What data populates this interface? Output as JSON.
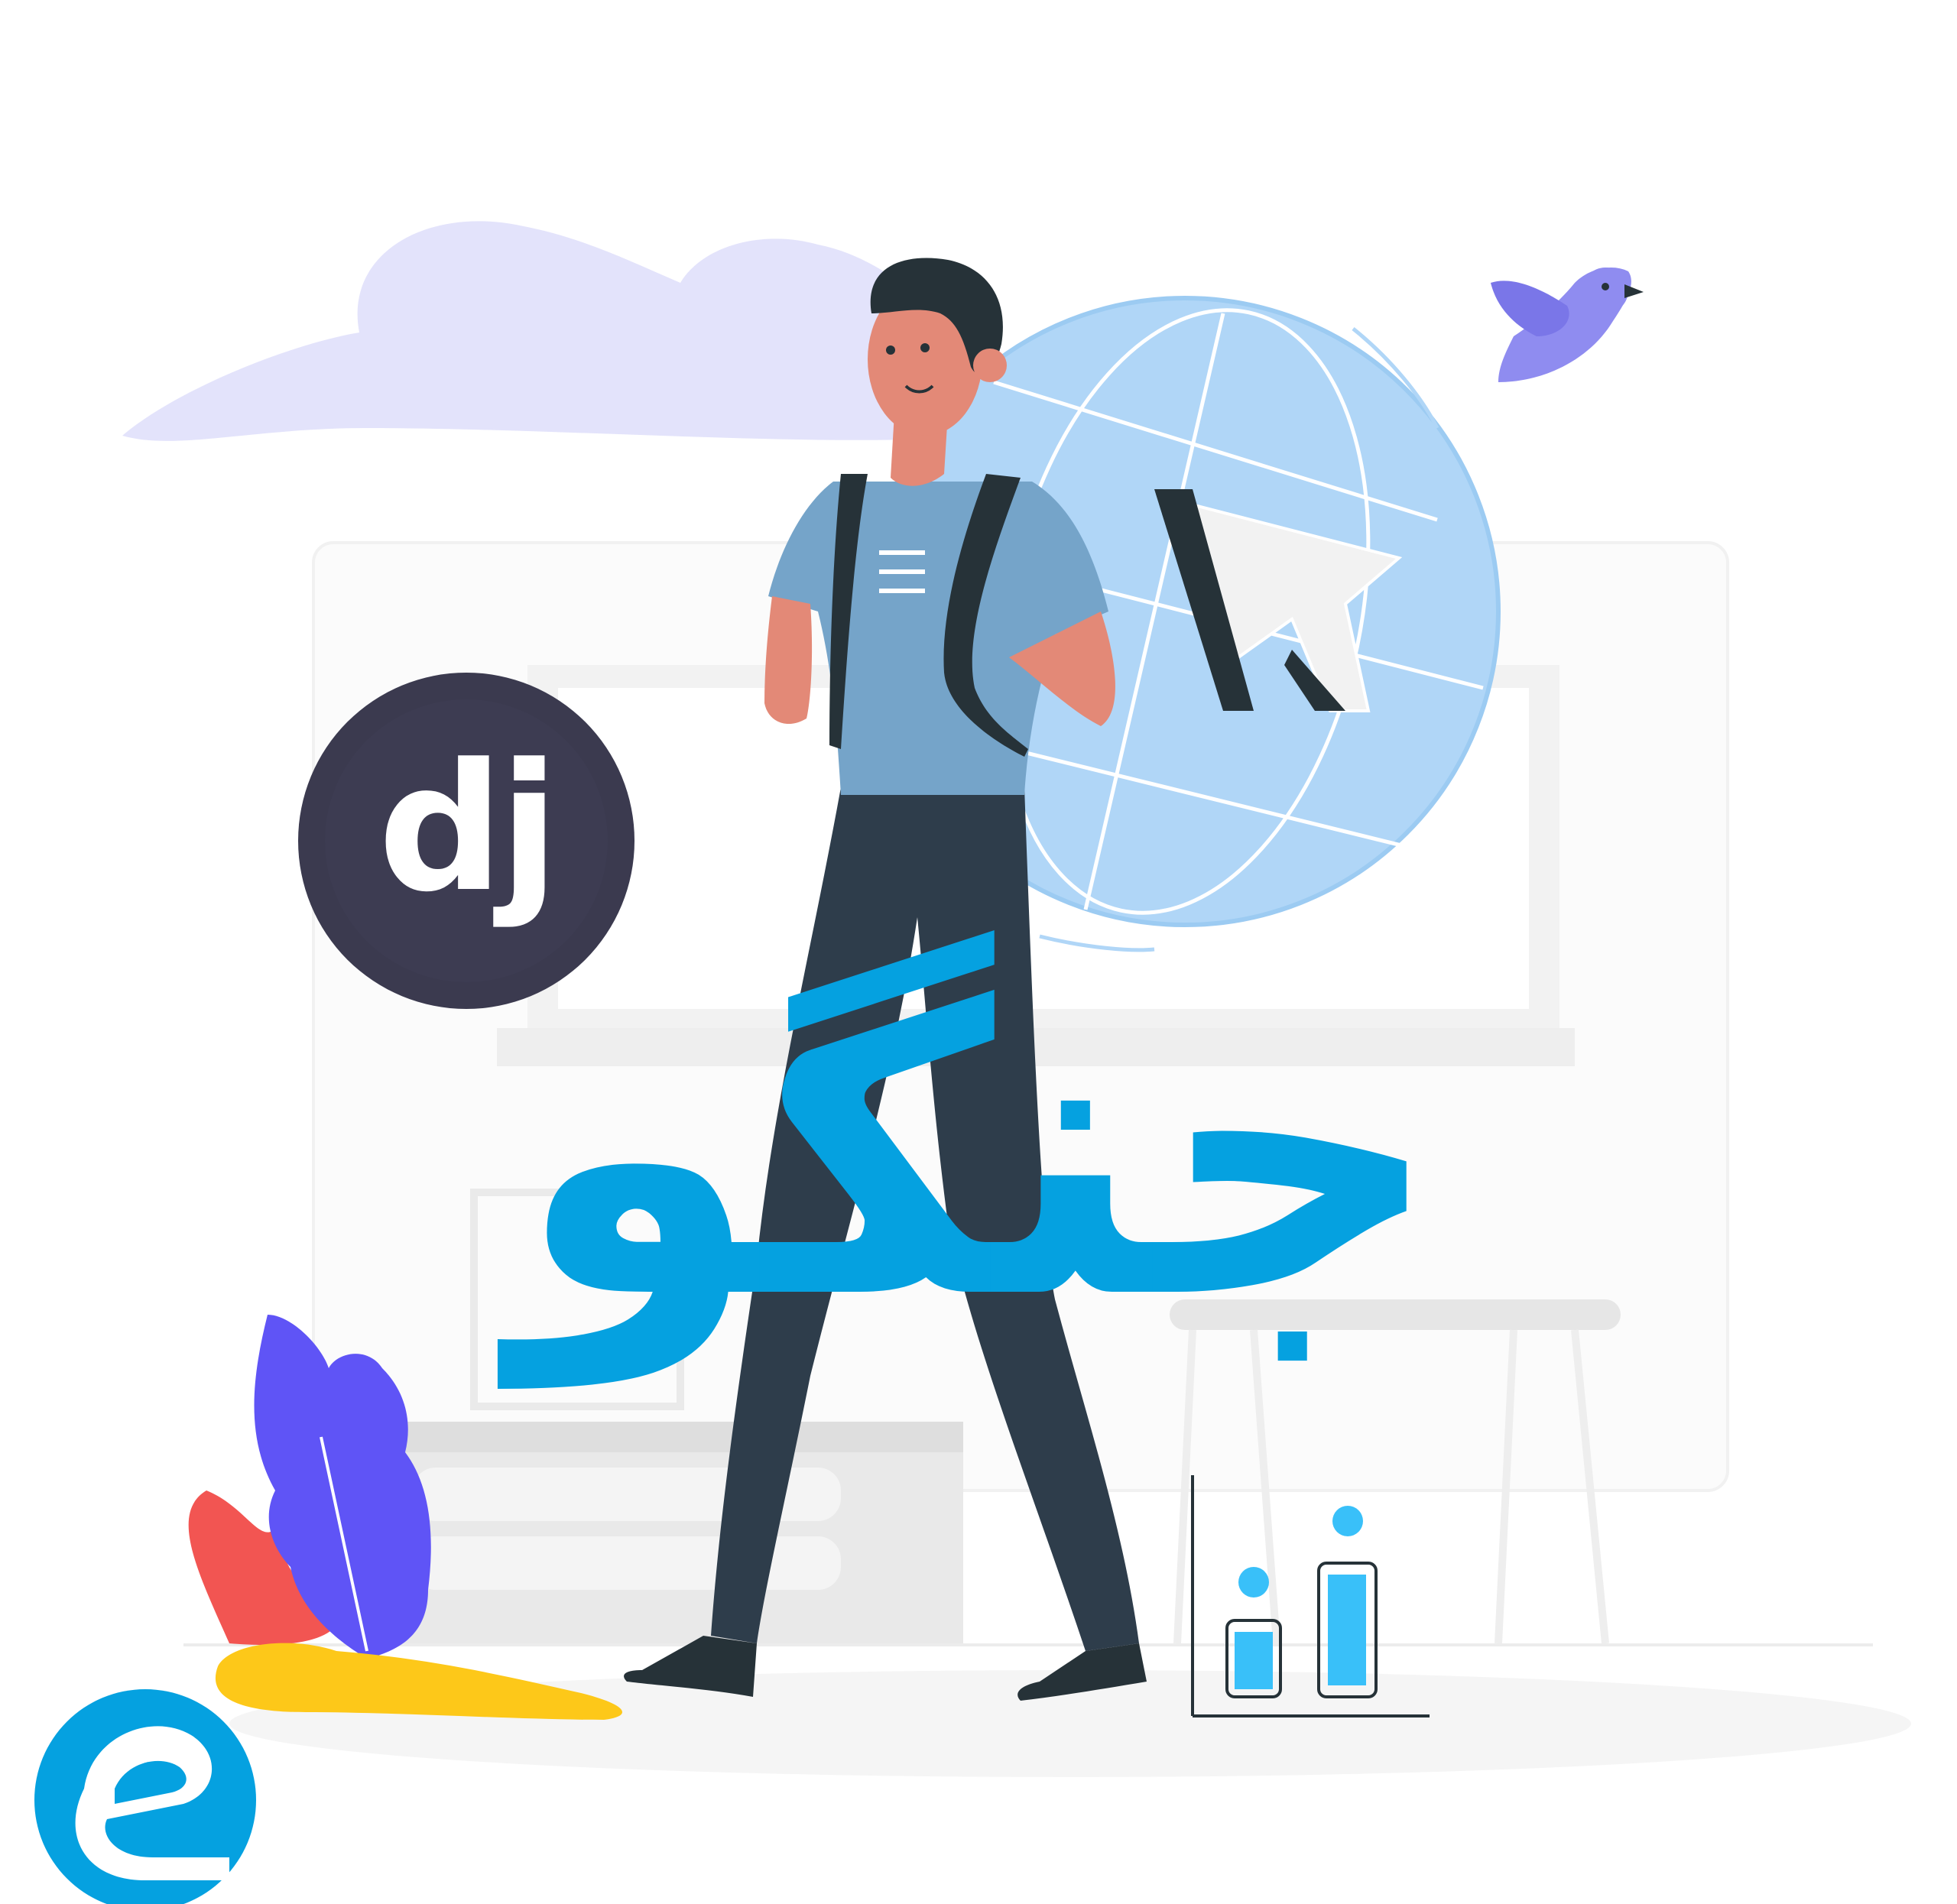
{
  "django_logo": {
    "text": "dj"
  },
  "headline": {
    "text": "جنگو"
  },
  "colors": {
    "headline_blue": "#05a1e0",
    "globe_blue": "#b0d6f7",
    "cloud": "#e3e3fb",
    "logo_dark": "#3b3a4f",
    "plant_blue": "#5f54f6",
    "plant_red": "#f25552",
    "plant_yellow": "#fdc819",
    "bird": "#8f8cf0",
    "shirt": "#75a4c9",
    "pants": "#2e3d4b",
    "skin": "#e38977",
    "bar_cyan": "#39c0f9"
  },
  "icons": [
    "cursor-arrow-icon",
    "bird-icon",
    "globe-icon",
    "bar-chart-icon",
    "brand-logo-icon"
  ]
}
